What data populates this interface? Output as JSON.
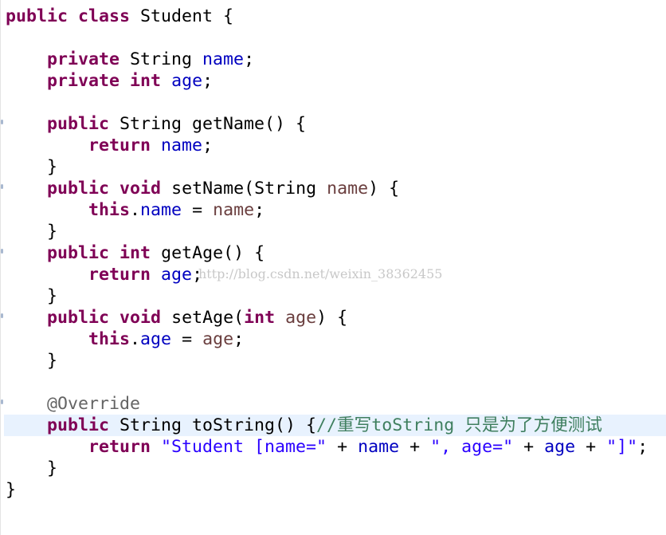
{
  "editor": {
    "highlighted_line": 19,
    "colors": {
      "keyword": "#7f0055",
      "field": "#0000c0",
      "parameter": "#6a3e3e",
      "string": "#2a00ff",
      "comment": "#3f7f5f",
      "annotation": "#646464",
      "current_line": "#e8f2fe"
    },
    "lines": [
      [
        [
          "public",
          "kw"
        ],
        [
          " ",
          "plain"
        ],
        [
          "class",
          "kw"
        ],
        [
          " Student {",
          "plain"
        ]
      ],
      [],
      [
        [
          "    ",
          "plain"
        ],
        [
          "private",
          "kw"
        ],
        [
          " String ",
          "plain"
        ],
        [
          "name",
          "field"
        ],
        [
          ";",
          "plain"
        ]
      ],
      [
        [
          "    ",
          "plain"
        ],
        [
          "private",
          "kw"
        ],
        [
          " ",
          "plain"
        ],
        [
          "int",
          "kw"
        ],
        [
          " ",
          "plain"
        ],
        [
          "age",
          "field"
        ],
        [
          ";",
          "plain"
        ]
      ],
      [],
      [
        [
          "    ",
          "plain"
        ],
        [
          "public",
          "kw"
        ],
        [
          " String getName() {",
          "plain"
        ]
      ],
      [
        [
          "        ",
          "plain"
        ],
        [
          "return",
          "kw"
        ],
        [
          " ",
          "plain"
        ],
        [
          "name",
          "field"
        ],
        [
          ";",
          "plain"
        ]
      ],
      [
        [
          "    }",
          "plain"
        ]
      ],
      [
        [
          "    ",
          "plain"
        ],
        [
          "public",
          "kw"
        ],
        [
          " ",
          "plain"
        ],
        [
          "void",
          "kw"
        ],
        [
          " setName(String ",
          "plain"
        ],
        [
          "name",
          "param"
        ],
        [
          ") {",
          "plain"
        ]
      ],
      [
        [
          "        ",
          "plain"
        ],
        [
          "this",
          "kw"
        ],
        [
          ".",
          "plain"
        ],
        [
          "name",
          "field"
        ],
        [
          " = ",
          "plain"
        ],
        [
          "name",
          "param"
        ],
        [
          ";",
          "plain"
        ]
      ],
      [
        [
          "    }",
          "plain"
        ]
      ],
      [
        [
          "    ",
          "plain"
        ],
        [
          "public",
          "kw"
        ],
        [
          " ",
          "plain"
        ],
        [
          "int",
          "kw"
        ],
        [
          " getAge() {",
          "plain"
        ]
      ],
      [
        [
          "        ",
          "plain"
        ],
        [
          "return",
          "kw"
        ],
        [
          " ",
          "plain"
        ],
        [
          "age",
          "field"
        ],
        [
          ";",
          "plain"
        ]
      ],
      [
        [
          "    }",
          "plain"
        ]
      ],
      [
        [
          "    ",
          "plain"
        ],
        [
          "public",
          "kw"
        ],
        [
          " ",
          "plain"
        ],
        [
          "void",
          "kw"
        ],
        [
          " setAge(",
          "plain"
        ],
        [
          "int",
          "kw"
        ],
        [
          " ",
          "plain"
        ],
        [
          "age",
          "param"
        ],
        [
          ") {",
          "plain"
        ]
      ],
      [
        [
          "        ",
          "plain"
        ],
        [
          "this",
          "kw"
        ],
        [
          ".",
          "plain"
        ],
        [
          "age",
          "field"
        ],
        [
          " = ",
          "plain"
        ],
        [
          "age",
          "param"
        ],
        [
          ";",
          "plain"
        ]
      ],
      [
        [
          "    }",
          "plain"
        ]
      ],
      [],
      [
        [
          "    ",
          "plain"
        ],
        [
          "@Override",
          "ann"
        ]
      ],
      [
        [
          "    ",
          "plain"
        ],
        [
          "public",
          "kw"
        ],
        [
          " String toString() {",
          "plain"
        ],
        [
          "//重写toString 只是为了方便测试",
          "cmt"
        ]
      ],
      [
        [
          "        ",
          "plain"
        ],
        [
          "return",
          "kw"
        ],
        [
          " ",
          "plain"
        ],
        [
          "\"Student [name=\"",
          "str"
        ],
        [
          " + ",
          "plain"
        ],
        [
          "name",
          "field"
        ],
        [
          " + ",
          "plain"
        ],
        [
          "\", age=\"",
          "str"
        ],
        [
          " + ",
          "plain"
        ],
        [
          "age",
          "field"
        ],
        [
          " + ",
          "plain"
        ],
        [
          "\"]\"",
          "str"
        ],
        [
          ";",
          "plain"
        ]
      ],
      [
        [
          "    }",
          "plain"
        ]
      ],
      [
        [
          "}",
          "plain"
        ]
      ]
    ]
  },
  "watermark": "http://blog.csdn.net/weixin_38362455"
}
